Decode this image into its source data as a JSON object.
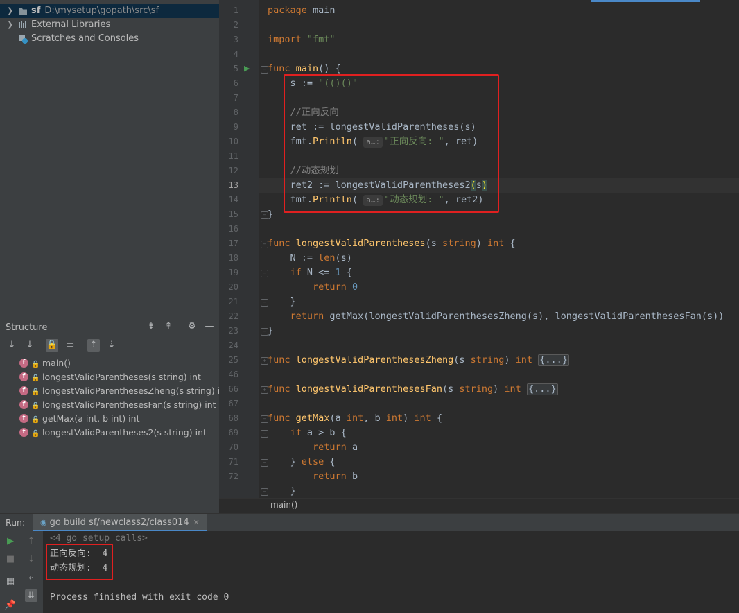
{
  "project_tree": {
    "items": [
      {
        "label": "sf",
        "path": "D:\\mysetup\\gopath\\src\\sf",
        "icon": "folder-icon"
      },
      {
        "label": "External Libraries",
        "icon": "library-icon"
      },
      {
        "label": "Scratches and Consoles",
        "icon": "scratches-icon"
      }
    ]
  },
  "structure": {
    "title": "Structure",
    "items": [
      {
        "label": "main()"
      },
      {
        "label": "longestValidParentheses(s string) int"
      },
      {
        "label": "longestValidParenthesesZheng(s string) int"
      },
      {
        "label": "longestValidParenthesesFan(s string) int"
      },
      {
        "label": "getMax(a int, b int) int"
      },
      {
        "label": "longestValidParentheses2(s string) int"
      }
    ]
  },
  "editor": {
    "line_numbers": [
      "1",
      "2",
      "3",
      "4",
      "5",
      "6",
      "7",
      "8",
      "9",
      "10",
      "11",
      "12",
      "13",
      "14",
      "15",
      "16",
      "17",
      "18",
      "19",
      "20",
      "21",
      "22",
      "23",
      "24",
      "25",
      "46",
      "66",
      "67",
      "68",
      "69",
      "70",
      "71",
      "72"
    ],
    "current_line": "13",
    "hint_label": "a…:",
    "fold_placeholder": "{...}",
    "breadcrumb": "main()",
    "comments": {
      "c1": "//正向反向",
      "c2": "//动态规划"
    },
    "strings": {
      "s1": "\"(()()\"",
      "s2": "\"正向反向: \"",
      "s3": "\"动态规划: \"",
      "fmt": "\"fmt\""
    }
  },
  "run": {
    "label": "Run:",
    "tab": "go build sf/newclass2/class014",
    "console": [
      "<4 go setup calls>",
      "正向反向:  4",
      "动态规划:  4",
      "",
      "Process finished with exit code 0"
    ]
  },
  "colors": {
    "keyword": "#cc7832",
    "string": "#6a8759",
    "function": "#ffc66d",
    "number": "#6897bb",
    "comment": "#808080",
    "highlight_box": "#e02020"
  }
}
